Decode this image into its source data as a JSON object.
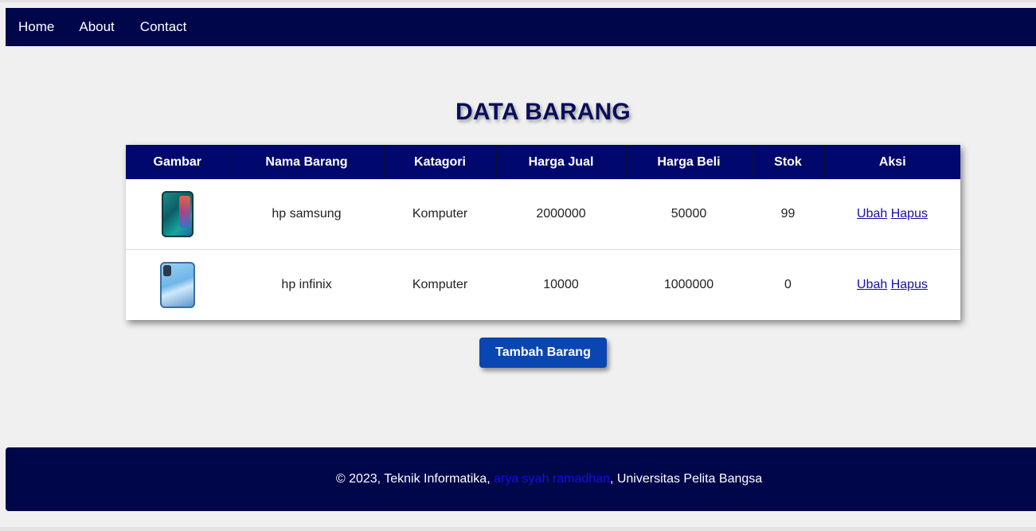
{
  "nav": {
    "home": "Home",
    "about": "About",
    "contact": "Contact"
  },
  "page": {
    "title": "DATA BARANG"
  },
  "table": {
    "headers": [
      "Gambar",
      "Nama Barang",
      "Katagori",
      "Harga Jual",
      "Harga Beli",
      "Stok",
      "Aksi"
    ],
    "rows": [
      {
        "image_icon": "samsung-phone-image",
        "nama": "hp samsung",
        "kategori": "Komputer",
        "harga_jual": "2000000",
        "harga_beli": "50000",
        "stok": "99",
        "edit": "Ubah",
        "delete": "Hapus"
      },
      {
        "image_icon": "infinix-phone-image",
        "nama": "hp infinix",
        "kategori": "Komputer",
        "harga_jual": "10000",
        "harga_beli": "1000000",
        "stok": "0",
        "edit": "Ubah",
        "delete": "Hapus"
      }
    ]
  },
  "actions": {
    "add_label": "Tambah Barang"
  },
  "footer": {
    "prefix": "© 2023, Teknik Informatika, ",
    "author": "arya syah ramadhan",
    "suffix": ", Universitas Pelita Bangsa"
  },
  "colors": {
    "navbar": "#00064a",
    "header_bg": "#00086d",
    "button": "#0a46b2",
    "link": "#1a0dab",
    "footer_author": "#1010e0"
  }
}
